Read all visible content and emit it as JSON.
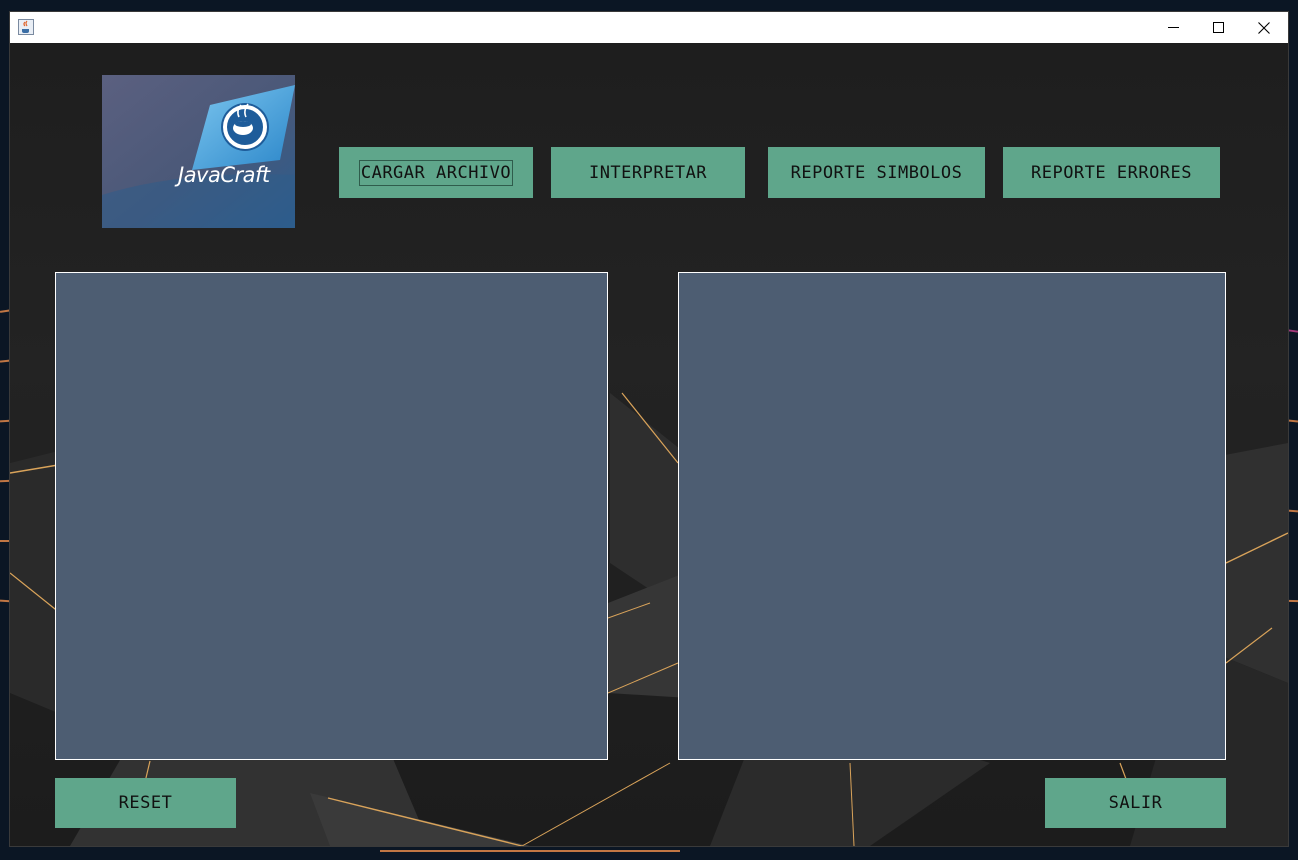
{
  "window": {
    "title": "",
    "controls": {
      "minimize": "—",
      "maximize": "☐",
      "close": "✕"
    }
  },
  "logo": {
    "text": "JavaCraft"
  },
  "toolbar": {
    "load_file": "CARGAR ARCHIVO",
    "interpret": "INTERPRETAR",
    "symbols_report": "REPORTE SIMBOLOS",
    "errors_report": "REPORTE ERRORES"
  },
  "editors": {
    "input_value": "",
    "output_value": ""
  },
  "footer": {
    "reset": "RESET",
    "exit": "SALIR"
  },
  "colors": {
    "button_bg": "#5fa68b",
    "textarea_bg": "#4d5d72",
    "content_bg": "#1f1f1f"
  }
}
